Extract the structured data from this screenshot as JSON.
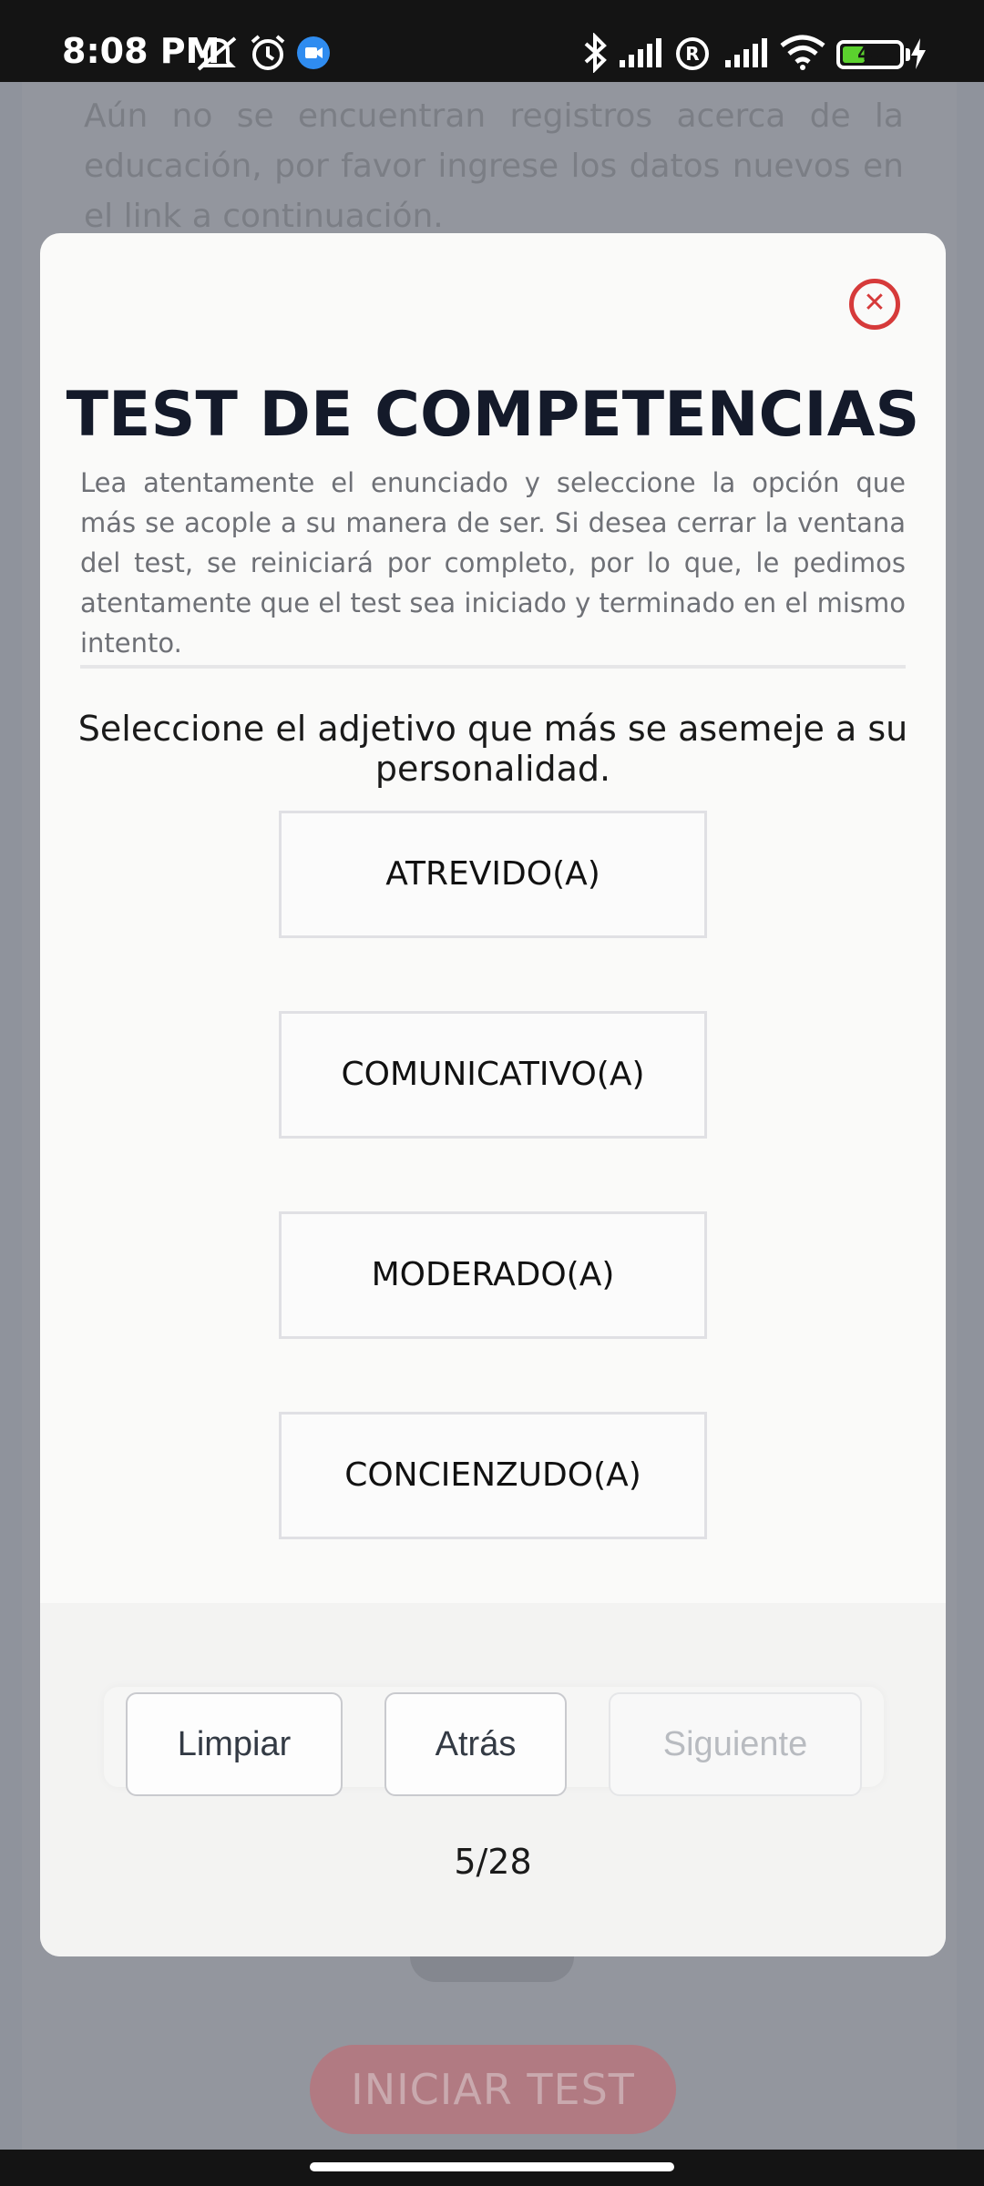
{
  "status_bar": {
    "time": "8:08 PM",
    "battery_level": "40",
    "battery_fraction": 0.4,
    "battery_color": "#5bd12e",
    "icons": [
      "mute-icon",
      "alarm-icon",
      "meet-icon",
      "bluetooth-icon",
      "signal-icon",
      "roaming-icon",
      "signal-icon",
      "wifi-icon",
      "battery-icon",
      "charging-icon"
    ]
  },
  "background": {
    "intro_text": "Aún no se encuentran registros acerca de la educación, por favor ingrese los datos nuevos en el link a continuación.",
    "start_button": "INICIAR TEST"
  },
  "modal": {
    "title": "TEST DE COMPETENCIAS",
    "instructions": "Lea atentamente el enunciado y seleccione la opción que más se acople a su manera de ser. Si desea cerrar la ventana del test, se reiniciará por completo, por lo que, le pedimos atentamente que el test sea iniciado y terminado en el mismo intento.",
    "question": "Seleccione el adjetivo que más se asemeje a su personalidad.",
    "options": [
      "ATREVIDO(A)",
      "COMUNICATIVO(A)",
      "MODERADO(A)",
      "CONCIENZUDO(A)"
    ],
    "buttons": {
      "clear": "Limpiar",
      "back": "Atrás",
      "next": "Siguiente"
    },
    "progress": "5/28",
    "close_color": "#d63a3a"
  }
}
